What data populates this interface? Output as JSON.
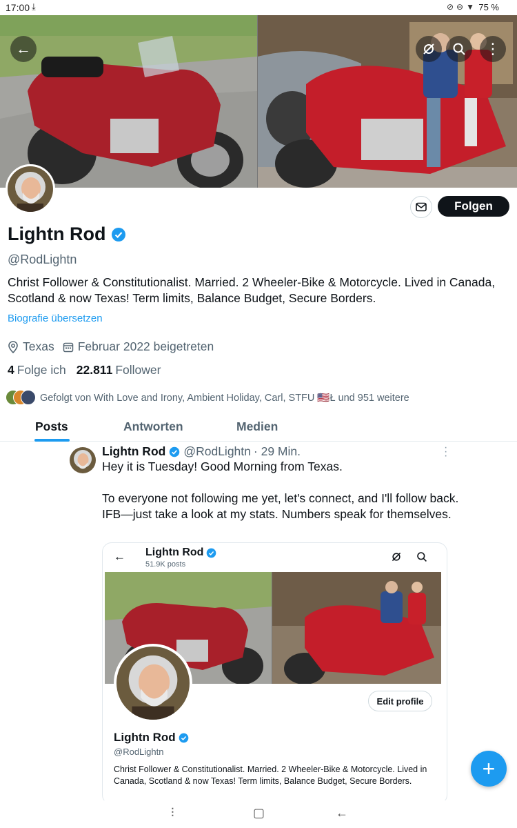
{
  "status_bar": {
    "time": "17:00",
    "battery": "75 %"
  },
  "icons": {
    "back": "arrow-left-icon",
    "spaces": "no-spaces-icon",
    "search": "search-icon",
    "more": "more-vertical-icon",
    "mail": "mail-icon",
    "location": "location-pin-icon",
    "calendar": "calendar-icon",
    "verified": "verified-badge-icon",
    "compose": "plus-icon"
  },
  "colors": {
    "accent": "#1d9bf0",
    "text": "#0f1419",
    "muted": "#536471",
    "follow_bg": "#0f1419"
  },
  "profile": {
    "name": "Lightn Rod",
    "handle": "@RodLightn",
    "bio": "Christ Follower & Constitutionalist. Married. 2 Wheeler-Bike & Motorcycle. Lived in Canada, Scotland & now Texas!  Term limits, Balance Budget, Secure Borders.",
    "translate_label": "Biografie übersetzen",
    "location": "Texas",
    "joined": "Februar 2022 beigetreten",
    "following_count": "4",
    "following_label": "Folge ich",
    "followers_count": "22.811",
    "followers_label": "Follower",
    "followed_by": "Gefolgt von With Love and Irony, Ambient Holiday, Carl, STFU 🇺🇸Ł und 951 weitere",
    "follow_button": "Folgen"
  },
  "tabs": [
    {
      "label": "Posts",
      "active": true
    },
    {
      "label": "Antworten",
      "active": false
    },
    {
      "label": "Medien",
      "active": false
    }
  ],
  "post": {
    "name": "Lightn Rod",
    "handle": "@RodLightn",
    "time": "· 29 Min.",
    "text": "Hey it is Tuesday!  Good Morning from Texas.\n\nTo everyone not following me yet, let's connect, and I'll follow back. IFB—just take a look at my stats. Numbers speak for themselves.",
    "embed": {
      "name": "Lightn Rod",
      "posts_count": "51.9K posts",
      "edit_button": "Edit profile",
      "handle": "@RodLightn",
      "bio": "Christ Follower & Constitutionalist. Married. 2 Wheeler-Bike & Motorcycle. Lived in Canada, Scotland & now Texas!  Term limits, Balance Budget, Secure Borders."
    }
  }
}
